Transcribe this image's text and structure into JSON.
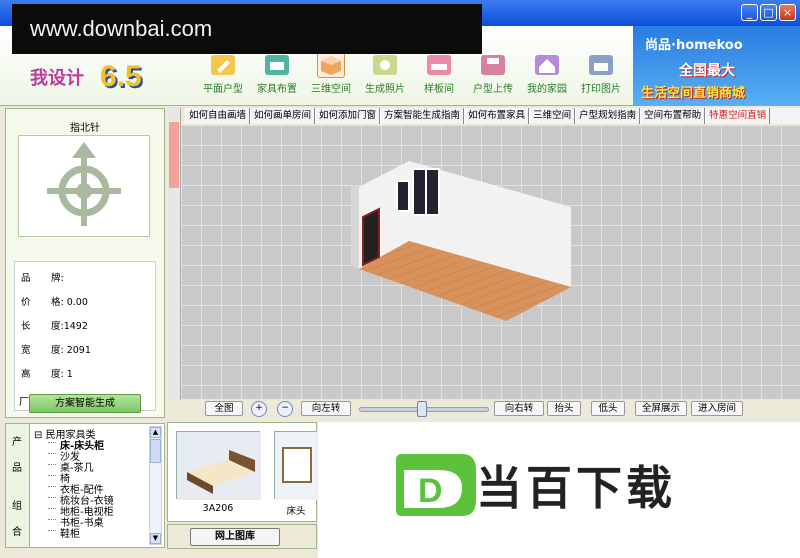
{
  "watermark": {
    "site": "www.downbai.com",
    "overlay_text": "当百下载",
    "overlay_letter": "D"
  },
  "window": {
    "minimize": "_",
    "maximize": "□",
    "close": "×"
  },
  "app": {
    "logo_text": "我设计",
    "version": "6.5"
  },
  "toolbar": {
    "items": [
      {
        "label": "平面户型",
        "icon": "pencil-icon"
      },
      {
        "label": "家具布置",
        "icon": "sofa-icon"
      },
      {
        "label": "三维空间",
        "icon": "cube-icon"
      },
      {
        "label": "生成照片",
        "icon": "camera-icon"
      },
      {
        "label": "样板间",
        "icon": "bed-icon"
      },
      {
        "label": "户型上传",
        "icon": "disk-icon"
      },
      {
        "label": "我的家园",
        "icon": "house-icon"
      },
      {
        "label": "打印图片",
        "icon": "printer-icon"
      }
    ]
  },
  "promo": {
    "brand": "尚品·homekoo",
    "line1": "全国最大",
    "line2": "生活空间直销商城"
  },
  "compass": {
    "title": "指北针"
  },
  "properties": [
    {
      "key": "品",
      "value": "牌:"
    },
    {
      "key": "价",
      "value": "格: 0.00"
    },
    {
      "key": "长",
      "value": "度:1492"
    },
    {
      "key": "宽",
      "value": "度: 2091"
    },
    {
      "key": "高",
      "value": "度: 1"
    }
  ],
  "properties_extra_key": "厂",
  "smart_generate_button": "方案智能生成",
  "help_links": [
    "如何自由画墙",
    "如何画单房间",
    "如何添加门窗",
    "方案智能生成指南",
    "如何布置家具",
    "三维空间",
    "户型规划指南",
    "空间布置帮助",
    "特惠空间直销"
  ],
  "bottom_controls": {
    "full_view": "全图",
    "zoom_in": "+",
    "zoom_out": "−",
    "rotate_left": "向左转",
    "rotate_right": "向右转",
    "look_up": "抬头",
    "look_down": "低头",
    "fullscreen": "全屏展示",
    "enter_room": "进入房间"
  },
  "tree_tabs": [
    "产品",
    "组合"
  ],
  "tree": {
    "root": "民用家具类",
    "children": [
      "床-床头柜",
      "沙发",
      "桌-茶几",
      "椅",
      "衣柜-配件",
      "梳妆台-衣镜",
      "地柜-电视柜",
      "书柜-书桌",
      "鞋柜"
    ]
  },
  "catalog": {
    "items": [
      {
        "code": "3A206"
      },
      {
        "code": "床头"
      }
    ],
    "online_button": "网上图库"
  }
}
